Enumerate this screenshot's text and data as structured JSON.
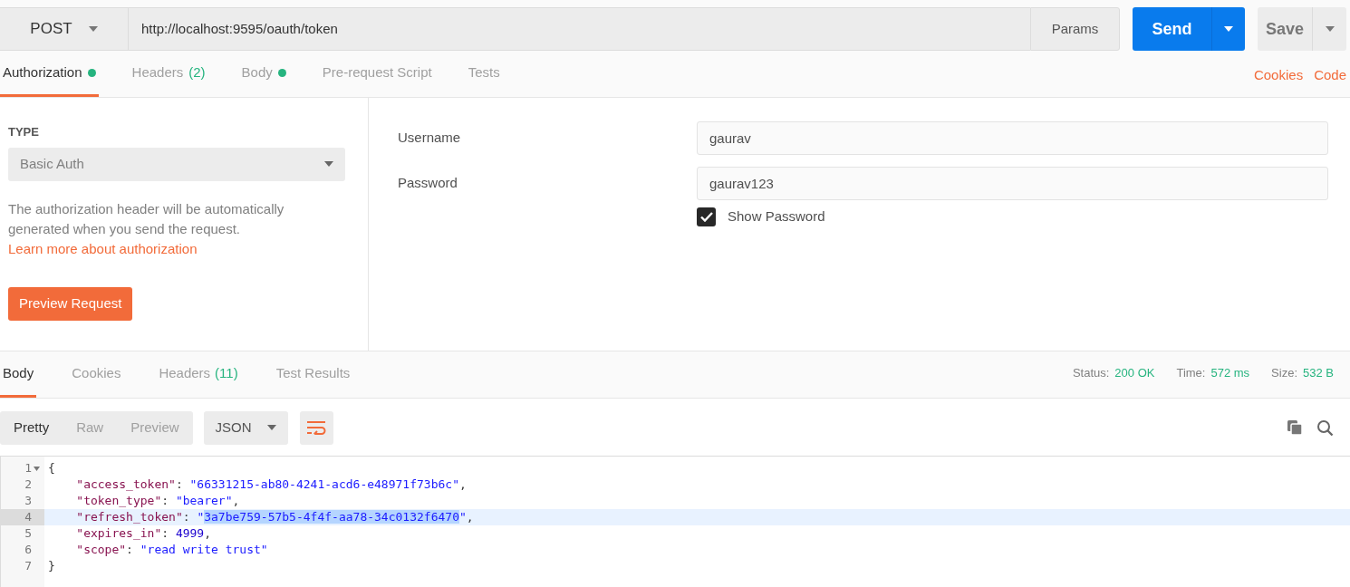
{
  "request": {
    "method": "POST",
    "url": "http://localhost:9595/oauth/token",
    "params_button": "Params",
    "send_button": "Send",
    "save_button": "Save"
  },
  "request_tabs": [
    {
      "label": "Authorization",
      "dot": true,
      "selected": true
    },
    {
      "label": "Headers",
      "count": "(2)",
      "dot": false,
      "selected": false
    },
    {
      "label": "Body",
      "dot": true,
      "selected": false
    },
    {
      "label": "Pre-request Script",
      "dot": false,
      "selected": false
    },
    {
      "label": "Tests",
      "dot": false,
      "selected": false
    }
  ],
  "request_links": [
    "Cookies",
    "Code"
  ],
  "auth": {
    "type_label": "TYPE",
    "type_value": "Basic Auth",
    "description": "The authorization header will be automatically generated when you send the request.",
    "learn_more_link": "Learn more about authorization",
    "preview_button": "Preview Request",
    "fields": [
      {
        "label": "Username",
        "value": "gaurav"
      },
      {
        "label": "Password",
        "value": "gaurav123"
      }
    ],
    "show_password": {
      "label": "Show Password",
      "checked": true
    }
  },
  "response_tabs": [
    {
      "label": "Body",
      "selected": true
    },
    {
      "label": "Cookies",
      "selected": false
    },
    {
      "label": "Headers",
      "count": "(11)",
      "selected": false
    },
    {
      "label": "Test Results",
      "selected": false
    }
  ],
  "response_stats": [
    {
      "label": "Status:",
      "value": "200 OK"
    },
    {
      "label": "Time:",
      "value": "572 ms"
    },
    {
      "label": "Size:",
      "value": "532 B"
    }
  ],
  "view_modes": [
    {
      "label": "Pretty",
      "selected": true
    },
    {
      "label": "Raw",
      "selected": false
    },
    {
      "label": "Preview",
      "selected": false
    }
  ],
  "format": "JSON",
  "code_lines": [
    {
      "number": "1",
      "fold": true,
      "active": false,
      "tokens": [
        {
          "kind": "punct",
          "text": "{"
        }
      ]
    },
    {
      "number": "2",
      "fold": false,
      "active": false,
      "tokens": [
        {
          "kind": "key",
          "text": "    \"access_token\""
        },
        {
          "kind": "punct",
          "text": ": "
        },
        {
          "kind": "string",
          "text": "\"66331215-ab80-4241-acd6-e48971f73b6c\""
        },
        {
          "kind": "punct",
          "text": ","
        }
      ]
    },
    {
      "number": "3",
      "fold": false,
      "active": false,
      "tokens": [
        {
          "kind": "key",
          "text": "    \"token_type\""
        },
        {
          "kind": "punct",
          "text": ": "
        },
        {
          "kind": "string",
          "text": "\"bearer\""
        },
        {
          "kind": "punct",
          "text": ","
        }
      ]
    },
    {
      "number": "4",
      "fold": false,
      "active": true,
      "tokens": [
        {
          "kind": "key",
          "text": "    \"refresh_token\""
        },
        {
          "kind": "punct",
          "text": ": "
        },
        {
          "kind": "string",
          "text": "\""
        },
        {
          "kind": "selection",
          "text": "3a7be759-57b5-4f4f-aa78-34c0132f6470"
        },
        {
          "kind": "string",
          "text": "\""
        },
        {
          "kind": "punct",
          "text": ","
        }
      ]
    },
    {
      "number": "5",
      "fold": false,
      "active": false,
      "tokens": [
        {
          "kind": "key",
          "text": "    \"expires_in\""
        },
        {
          "kind": "punct",
          "text": ": "
        },
        {
          "kind": "number",
          "text": "4999"
        },
        {
          "kind": "punct",
          "text": ","
        }
      ]
    },
    {
      "number": "6",
      "fold": false,
      "active": false,
      "tokens": [
        {
          "kind": "key",
          "text": "    \"scope\""
        },
        {
          "kind": "punct",
          "text": ": "
        },
        {
          "kind": "string",
          "text": "\"read write trust\""
        }
      ]
    },
    {
      "number": "7",
      "fold": false,
      "active": false,
      "tokens": [
        {
          "kind": "punct",
          "text": "}"
        }
      ]
    }
  ]
}
